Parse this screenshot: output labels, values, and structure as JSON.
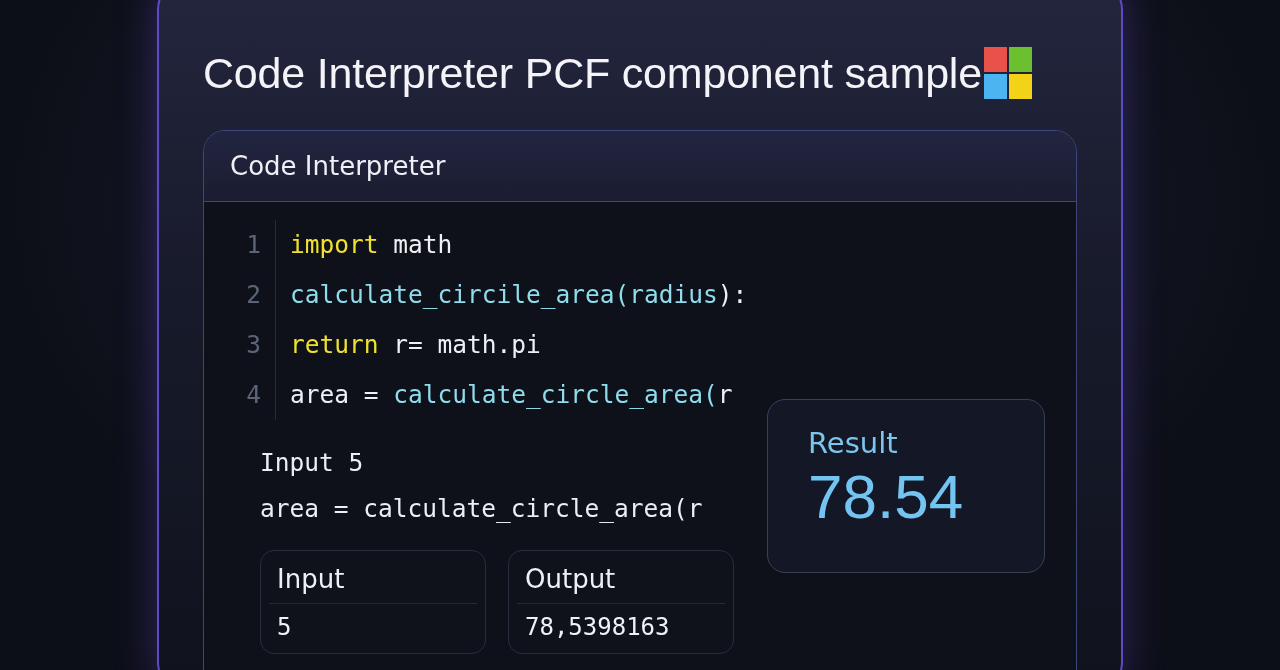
{
  "title": "Code Interpreter PCF component sample",
  "panel": {
    "title": "Code Interpreter",
    "code_lines": [
      {
        "number": "1",
        "tokens": [
          {
            "text": "import",
            "kind": "keyword"
          },
          {
            "text": " math",
            "kind": "plain"
          }
        ]
      },
      {
        "number": "2",
        "tokens": [
          {
            "text": "calculate_circile_area(radius",
            "kind": "function"
          },
          {
            "text": "):",
            "kind": "plain"
          }
        ]
      },
      {
        "number": "3",
        "tokens": [
          {
            "text": "return",
            "kind": "keyword"
          },
          {
            "text": " r= math.pi",
            "kind": "plain"
          }
        ]
      },
      {
        "number": "4",
        "tokens": [
          {
            "text": "area = ",
            "kind": "plain"
          },
          {
            "text": "calculate_circle_area(",
            "kind": "function"
          },
          {
            "text": "r",
            "kind": "plain"
          }
        ]
      }
    ],
    "output_lines": [
      "Input 5",
      "area = calculate_circle_area(r"
    ],
    "tables": [
      {
        "header": "Input",
        "value": "5"
      },
      {
        "header": "Output",
        "value": "78,5398163"
      }
    ],
    "result": {
      "label": "Result",
      "value": "78.54"
    }
  }
}
